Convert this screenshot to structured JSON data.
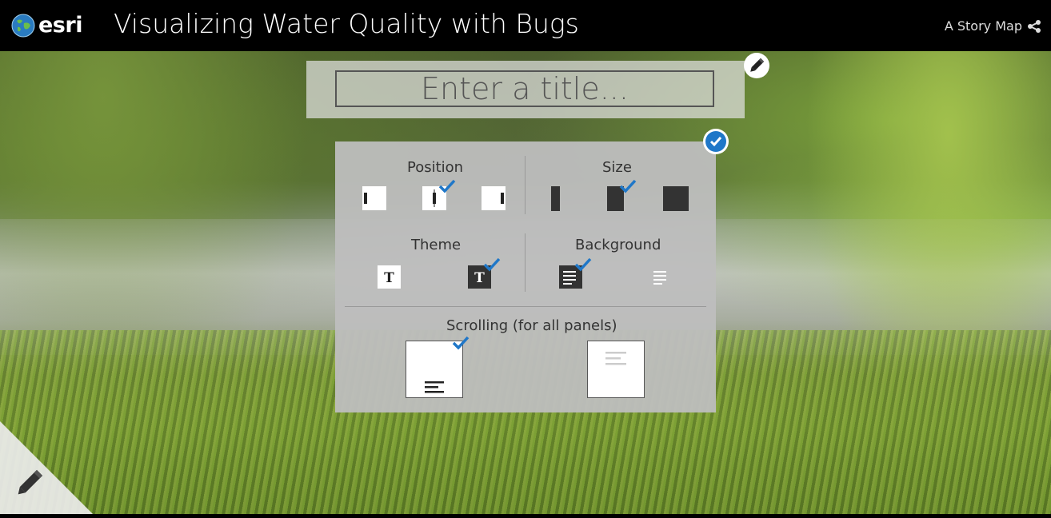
{
  "header": {
    "logo_text": "esri",
    "title": "Visualizing Water Quality with Bugs",
    "story_map_label": "A Story Map",
    "background_color": "#000000"
  },
  "title_editor": {
    "placeholder": "Enter a title...",
    "edit_icon": "pencil-icon"
  },
  "settings_panel": {
    "confirm_icon": "check-circle-icon",
    "position": {
      "label": "Position",
      "options": [
        "left",
        "center",
        "right"
      ],
      "selected": "center"
    },
    "size": {
      "label": "Size",
      "options": [
        "small",
        "medium",
        "large"
      ],
      "selected": "medium"
    },
    "theme": {
      "label": "Theme",
      "options": [
        "light",
        "dark"
      ],
      "selected": "dark",
      "glyph": "T"
    },
    "background": {
      "label": "Background",
      "options": [
        "opaque",
        "transparent"
      ],
      "selected": "opaque"
    },
    "scrolling": {
      "label": "Scrolling (for all panels)",
      "options": [
        "scroll",
        "fixed"
      ],
      "selected": "scroll"
    }
  },
  "colors": {
    "accent": "#1f77c8",
    "panel": "#bebebe",
    "dark_option": "#333333"
  }
}
